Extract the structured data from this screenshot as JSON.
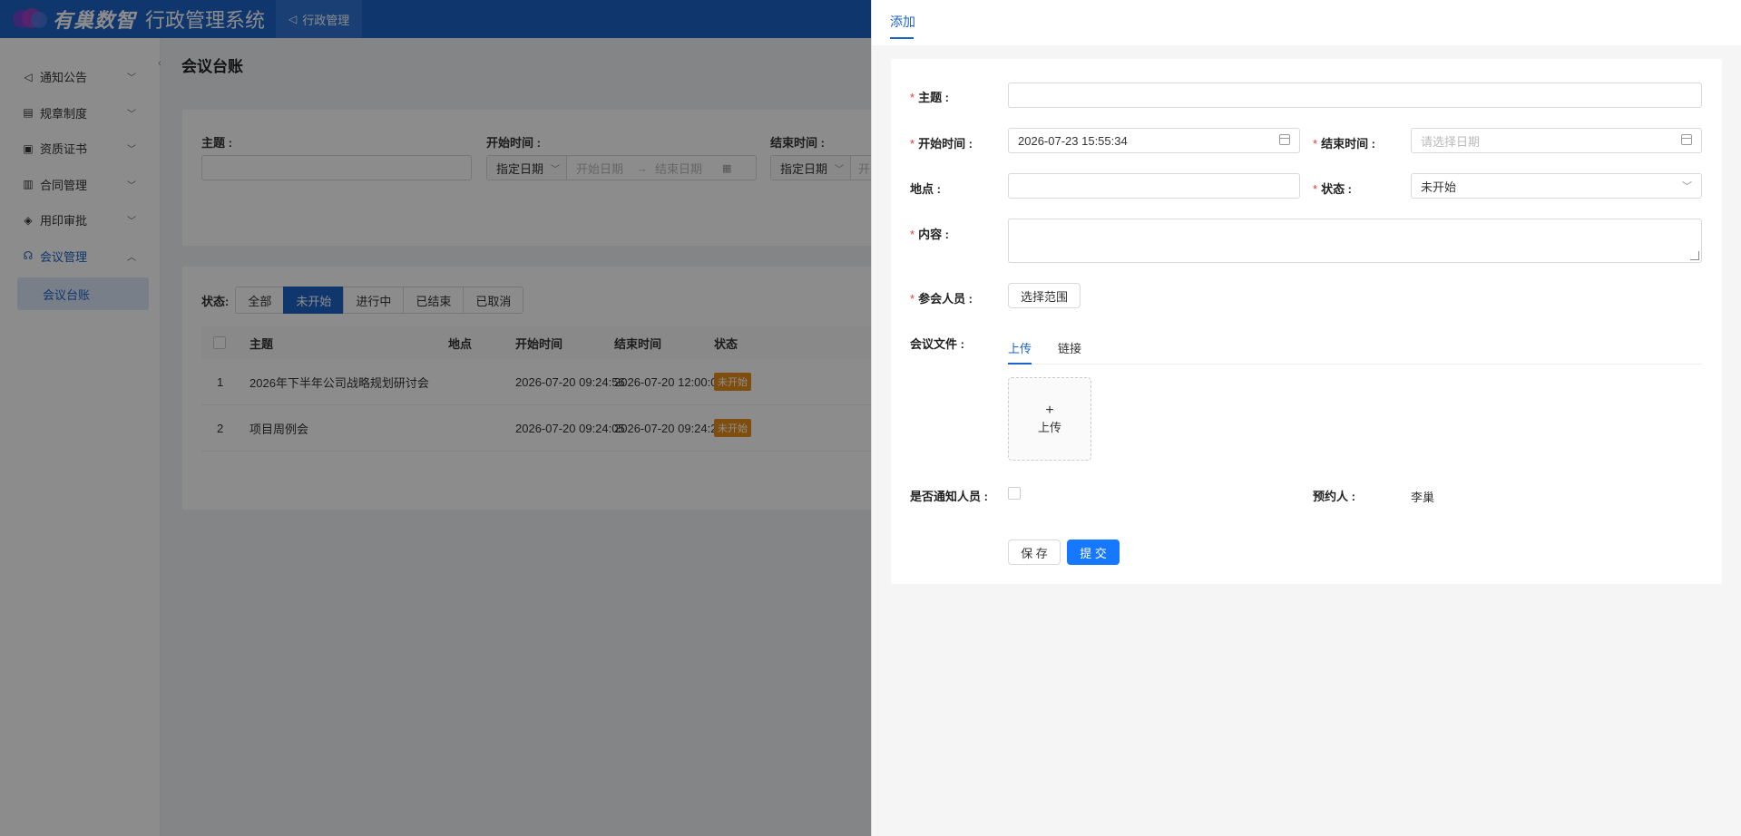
{
  "app": {
    "logo_text": "有巢数智",
    "system_title": "行政管理系统",
    "top_nav_label": "行政管理"
  },
  "sidebar": {
    "items": [
      {
        "label": "通知公告",
        "icon": "megaphone-icon"
      },
      {
        "label": "规章制度",
        "icon": "document-icon"
      },
      {
        "label": "资质证书",
        "icon": "certificate-icon"
      },
      {
        "label": "合同管理",
        "icon": "contract-icon"
      },
      {
        "label": "用印审批",
        "icon": "seal-icon"
      },
      {
        "label": "会议管理",
        "icon": "meeting-icon"
      }
    ],
    "active_sub": "会议台账"
  },
  "page": {
    "title": "会议台账",
    "filters": {
      "subject_label": "主题 :",
      "start_label": "开始时间 :",
      "end_label": "结束时间 :",
      "date_mode": "指定日期",
      "start_placeholder": "开始日期",
      "end_placeholder": "结束日期",
      "arrow": "→",
      "partial_text": "开"
    },
    "status_label": "状态:",
    "status_tabs": [
      "全部",
      "未开始",
      "进行中",
      "已结束",
      "已取消"
    ],
    "active_status": "未开始",
    "table": {
      "headers": [
        "主题",
        "地点",
        "开始时间",
        "结束时间",
        "状态"
      ],
      "rows": [
        {
          "index": "1",
          "subject": "2026年下半年公司战略规划研讨会",
          "location": "",
          "start": "2026-07-20 09:24:56",
          "end": "2026-07-20 12:00:00",
          "status": "未开始"
        },
        {
          "index": "2",
          "subject": "项目周例会",
          "location": "",
          "start": "2026-07-20 09:24:05",
          "end": "2026-07-20 09:24:22",
          "status": "未开始"
        }
      ]
    }
  },
  "drawer": {
    "tab": "添加",
    "form": {
      "subject_label": "主题 :",
      "start_label": "开始时间 :",
      "start_value": "2026-07-23 15:55:34",
      "end_label": "结束时间 :",
      "end_placeholder": "请选择日期",
      "location_label": "地点 :",
      "status_label": "状态 :",
      "status_value": "未开始",
      "content_label": "内容 :",
      "attendees_label": "参会人员 :",
      "attendees_button": "选择范围",
      "files_label": "会议文件 :",
      "file_tabs": [
        "上传",
        "链接"
      ],
      "upload_plus": "+",
      "upload_text": "上传",
      "notify_label": "是否通知人员 :",
      "booker_label": "预约人 :",
      "booker_value": "李巢",
      "save_button": "保 存",
      "submit_button": "提 交",
      "required_mark": "*"
    }
  },
  "colors": {
    "primary": "#1d63c7",
    "submit": "#1677ff",
    "tag_orange": "#e88f1c",
    "required": "#e53935"
  }
}
